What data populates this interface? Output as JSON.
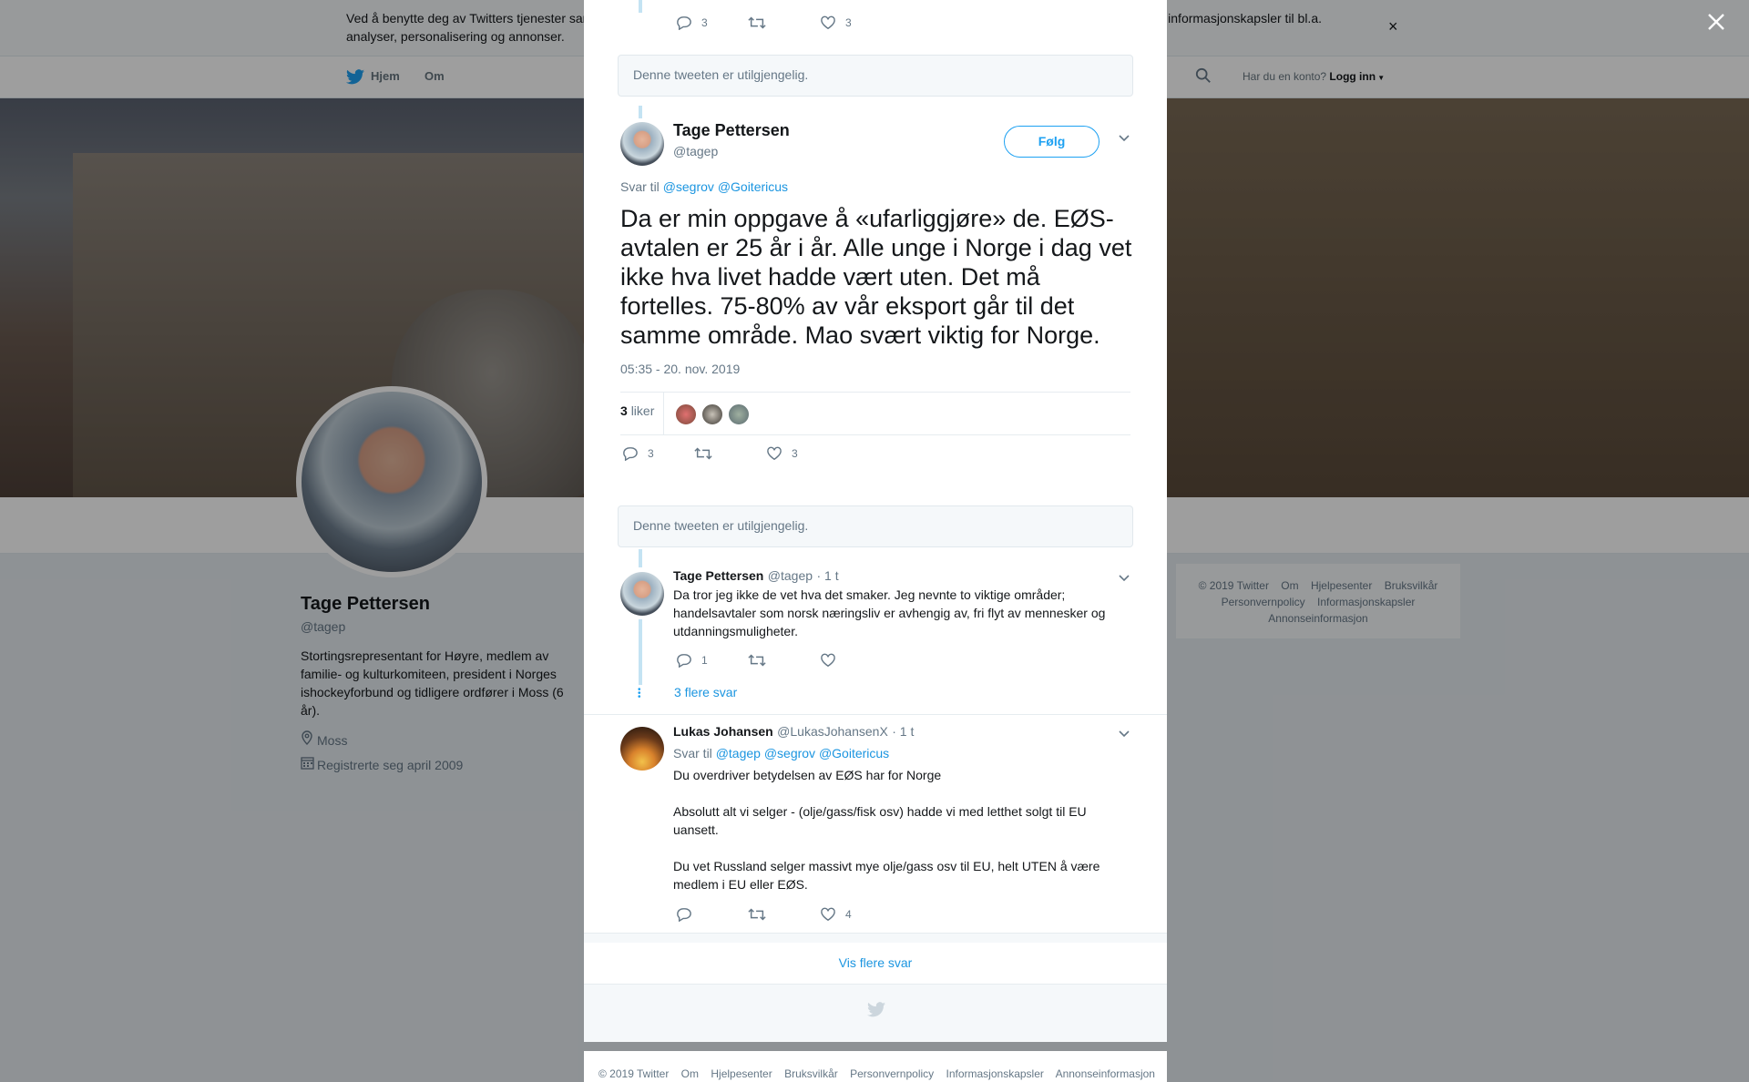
{
  "cookie": {
    "text": "Ved å benytte deg av Twitters tjenester samtykker du til vår bruk av informasjonskapsler og dataoverføring utenfor EU. Vi og våre partnere bruker informasjonskapsler til bl.a. analyser, personalisering og annonser.",
    "close": "×"
  },
  "nav": {
    "home": "Hjem",
    "about": "Om",
    "login_question": "Har du en konto?",
    "login": "Logg inn"
  },
  "profile": {
    "name": "Tage Pettersen",
    "handle": "@tagep",
    "bio": "Stortingsrepresentant for Høyre, medlem av familie- og kulturkomiteen, president i Norges ishockeyforbund og tidligere ordfører i Moss (6 år).",
    "location": "Moss",
    "joined": "Registrerte seg april 2009"
  },
  "right_footer": [
    "© 2019 Twitter",
    "Om",
    "Hjelpesenter",
    "Bruksvilkår",
    "Personvernpolicy",
    "Informasjonskapsler",
    "Annonseinformasjon"
  ],
  "modal": {
    "top_actions": {
      "replies": "3",
      "likes": "3"
    },
    "unavailable_1": "Denne tweeten er utilgjengelig.",
    "main": {
      "name": "Tage Pettersen",
      "handle": "@tagep",
      "follow": "Følg",
      "reply_to_label": "Svar til",
      "reply_to_1": "@segrov",
      "reply_to_2": "@Goitericus",
      "text": "Da er min oppgave å «ufarliggjøre» de. EØS-avtalen er 25 år i år. Alle unge i Norge i dag vet ikke hva livet hadde vært uten. Det må fortelles. 75-80% av vår eksport går til det samme område. Mao svært viktig for Norge.",
      "time": "05:35 - 20. nov. 2019",
      "likes_count": "3",
      "likes_label": "liker",
      "replies": "3",
      "likes": "3"
    },
    "unavailable_2": "Denne tweeten er utilgjengelig.",
    "reply1": {
      "name": "Tage Pettersen",
      "handle": "@tagep",
      "time": "· 1 t",
      "text": "Da tror jeg ikke de vet hva det smaker. Jeg nevnte to viktige områder; handelsavtaler som norsk næringsliv er avhengig av, fri flyt av mennesker og utdanningsmuligheter.",
      "replies": "1",
      "more": "3 flere svar"
    },
    "reply2": {
      "name": "Lukas Johansen",
      "handle": "@LukasJohansenX",
      "time": "· 1 t",
      "reply_to_label": "Svar til",
      "reply_to_1": "@tagep",
      "reply_to_2": "@segrov",
      "reply_to_3": "@Goitericus",
      "para1": "Du overdriver betydelsen av EØS har for Norge",
      "para2": "Absolutt alt vi selger - (olje/gass/fisk osv) hadde vi med letthet solgt til EU uansett.",
      "para3": "Du vet Russland selger massivt mye olje/gass osv til EU, helt UTEN å være medlem i EU eller EØS.",
      "likes": "4"
    },
    "show_more": "Vis flere svar"
  },
  "modal_footer": [
    "© 2019 Twitter",
    "Om",
    "Hjelpesenter",
    "Bruksvilkår",
    "Personvernpolicy",
    "Informasjonskapsler",
    "Annonseinformasjon"
  ],
  "colors": {
    "twitter_blue": "#1da1f2",
    "link": "#1b95e0",
    "muted": "#657786"
  }
}
